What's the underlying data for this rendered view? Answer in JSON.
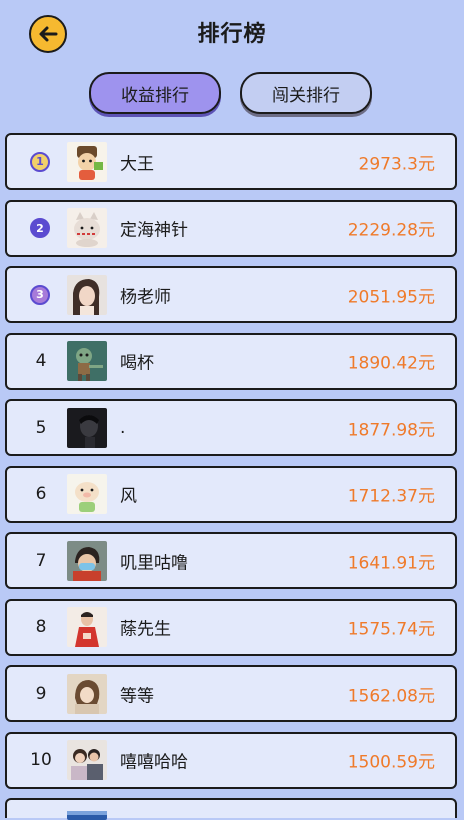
{
  "header": {
    "title": "排行榜"
  },
  "tabs": [
    {
      "label": "收益排行",
      "active": true
    },
    {
      "label": "闯关排行",
      "active": false
    }
  ],
  "ranking": [
    {
      "rank": "1",
      "name": "大王",
      "amount": "2973.3元",
      "medal": "gold",
      "avatar": "cartoon-character-avatar"
    },
    {
      "rank": "2",
      "name": "定海神针",
      "amount": "2229.28元",
      "medal": "silver",
      "avatar": "cartoon-cat-avatar"
    },
    {
      "rank": "3",
      "name": "杨老师",
      "amount": "2051.95元",
      "medal": "bronze",
      "avatar": "portrait-photo-avatar"
    },
    {
      "rank": "4",
      "name": "喝杯",
      "amount": "1890.42元",
      "avatar": "cartoon-zombie-avatar"
    },
    {
      "rank": "5",
      "name": ".",
      "amount": "1877.98元",
      "avatar": "dark-portrait-avatar"
    },
    {
      "rank": "6",
      "name": "风",
      "amount": "1712.37元",
      "avatar": "cartoon-pig-avatar"
    },
    {
      "rank": "7",
      "name": "叽里咕噜",
      "amount": "1641.91元",
      "avatar": "masked-person-avatar"
    },
    {
      "rank": "8",
      "name": "蒢先生",
      "amount": "1575.74元",
      "avatar": "red-outfit-avatar"
    },
    {
      "rank": "9",
      "name": "等等",
      "amount": "1562.08元",
      "avatar": "blurred-portrait-avatar"
    },
    {
      "rank": "10",
      "name": "嘻嘻哈哈",
      "amount": "1500.59元",
      "avatar": "couple-photo-avatar"
    }
  ],
  "colors": {
    "background": "#b9c9f6",
    "row_background": "#e3e9fb",
    "amount": "#ef7a2a",
    "active_tab": "#9e93ee",
    "back_button": "#f6b930"
  }
}
